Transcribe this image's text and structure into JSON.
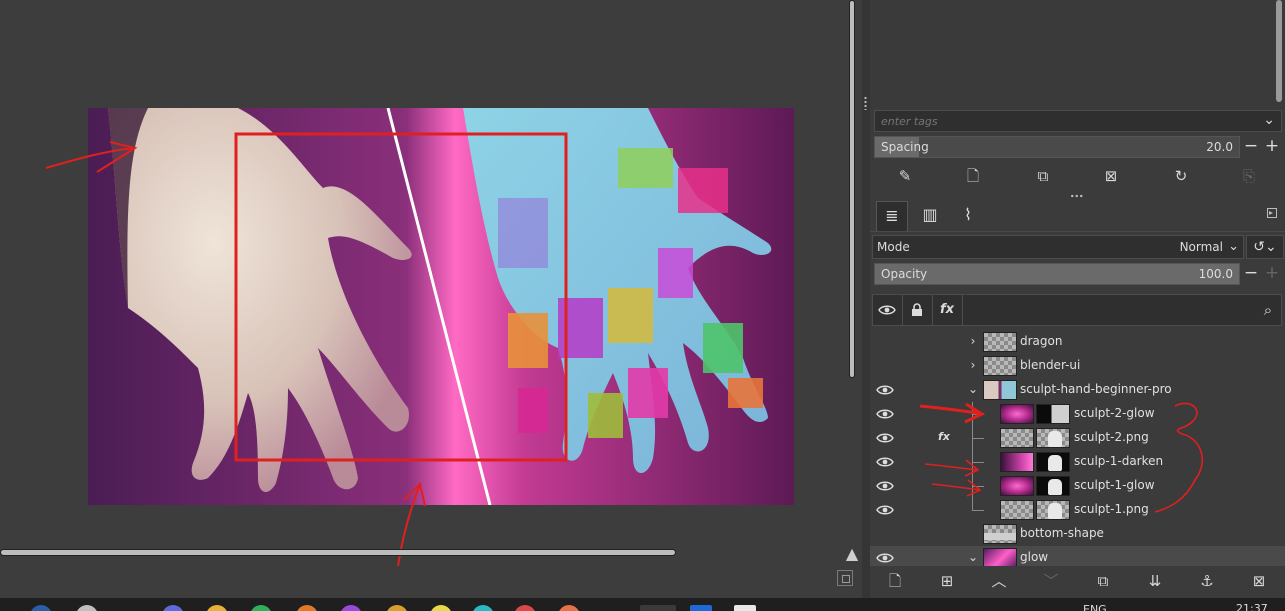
{
  "brushes": {
    "tags_placeholder": "enter tags",
    "spacing_label": "Spacing",
    "spacing_value": "20.0",
    "spacing_fraction": 0.12
  },
  "layers_panel": {
    "mode_label": "Mode",
    "mode_value": "Normal",
    "opacity_label": "Opacity",
    "opacity_value": "100.0",
    "fx_label": "fx",
    "layers": [
      {
        "name": "dragon",
        "visible": false,
        "group": true,
        "expanded": false,
        "fx": false
      },
      {
        "name": "blender-ui",
        "visible": false,
        "group": true,
        "expanded": false,
        "fx": false
      },
      {
        "name": "sculpt-hand-beginner-pro",
        "visible": true,
        "group": true,
        "expanded": true,
        "fx": false
      },
      {
        "name": "sculpt-2-glow",
        "visible": true,
        "group": false,
        "fx": false
      },
      {
        "name": "sculpt-2.png",
        "visible": true,
        "group": false,
        "fx": true
      },
      {
        "name": "sculp-1-darken",
        "visible": true,
        "group": false,
        "fx": false
      },
      {
        "name": "sculpt-1-glow",
        "visible": true,
        "group": false,
        "fx": false
      },
      {
        "name": "sculpt-1.png",
        "visible": true,
        "group": false,
        "fx": false
      },
      {
        "name": "bottom-shape",
        "visible": false,
        "group": false,
        "fx": false
      },
      {
        "name": "glow",
        "visible": true,
        "group": true,
        "expanded": true,
        "fx": false
      }
    ]
  },
  "taskbar": {
    "language": "ENG",
    "clock": "21:37"
  },
  "colors": {
    "annotation_red": "#e0201e",
    "canvas_bg": "#3d3d3d",
    "panel_bg": "#3b3b3b"
  }
}
